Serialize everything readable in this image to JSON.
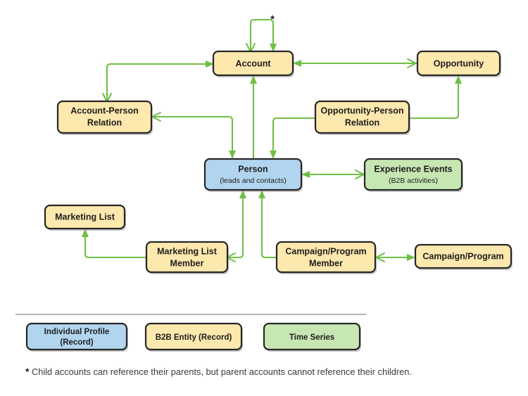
{
  "diagram": {
    "title": "B2B data model entity relationship diagram",
    "colors": {
      "yellow_fill": "#fde8ad",
      "blue_fill": "#b2d5ef",
      "green_fill": "#c7e7b2",
      "node_border": "#262626",
      "edge_green": "#6fbf45",
      "divider": "#8a8a8a",
      "text": "#1d1d1d"
    },
    "nodes": [
      {
        "id": "account",
        "label": "Account",
        "sub": "",
        "type": "b2b-entity"
      },
      {
        "id": "opportunity",
        "label": "Opportunity",
        "sub": "",
        "type": "b2b-entity"
      },
      {
        "id": "account-person-relation",
        "label": "Account-Person",
        "label2": "Relation",
        "sub": "",
        "type": "b2b-entity"
      },
      {
        "id": "opportunity-person-relation",
        "label": "Opportunity-Person",
        "label2": "Relation",
        "sub": "",
        "type": "b2b-entity"
      },
      {
        "id": "person",
        "label": "Person",
        "sub": "(leads and contacts)",
        "type": "individual-profile"
      },
      {
        "id": "experience-events",
        "label": "Experience Events",
        "sub": "(B2B activities)",
        "type": "time-series"
      },
      {
        "id": "marketing-list",
        "label": "Marketing List",
        "sub": "",
        "type": "b2b-entity"
      },
      {
        "id": "marketing-list-member",
        "label": "Marketing List",
        "label2": "Member",
        "sub": "",
        "type": "b2b-entity"
      },
      {
        "id": "campaign-program-member",
        "label": "Campaign/Program",
        "label2": "Member",
        "sub": "",
        "type": "b2b-entity"
      },
      {
        "id": "campaign-program",
        "label": "Campaign/Program",
        "sub": "",
        "type": "b2b-entity"
      }
    ],
    "annotation": {
      "asterisk": "*"
    },
    "legend": {
      "items": [
        {
          "id": "individual-profile",
          "label": "Individual Profile",
          "label2": "(Record)",
          "color": "#b2d5ef"
        },
        {
          "id": "b2b-entity",
          "label": "B2B Entity (Record)",
          "label2": "",
          "color": "#fde8ad"
        },
        {
          "id": "time-series",
          "label": "Time Series",
          "label2": "",
          "color": "#c7e7b2"
        }
      ]
    },
    "footnote": {
      "star": "*",
      "text": "Child accounts can reference their parents, but parent accounts cannot reference their children."
    }
  }
}
